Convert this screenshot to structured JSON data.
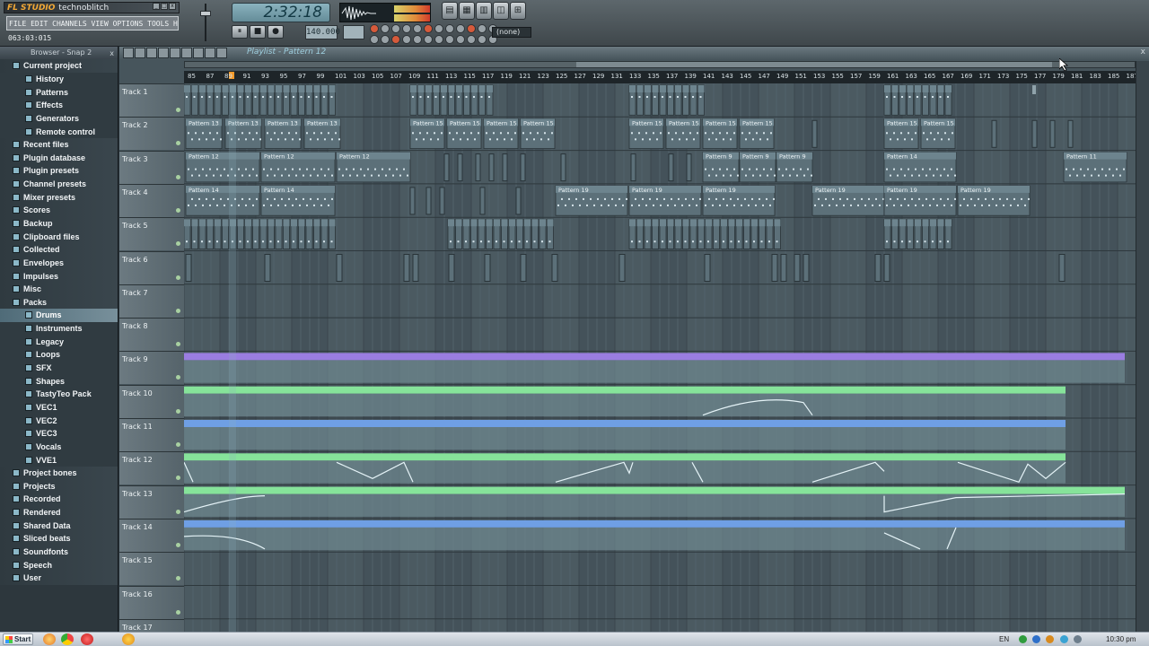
{
  "app": {
    "logo": "FL STUDIO",
    "user": "technoblitch",
    "menu_text": "FILE EDIT CHANNELS VIEW OPTIONS TOOLS HELP",
    "hint": "063:03:015",
    "window_buttons": [
      "_",
      "□",
      "x"
    ]
  },
  "transport": {
    "time_display": "2:32:18",
    "buttons": [
      "⏸",
      "■",
      "●"
    ],
    "bpm_display": "140.000",
    "pattern_selector": "(none)",
    "toolbar_icons": [
      "playlist-icon",
      "step-sequencer-icon",
      "piano-roll-icon",
      "browser-icon",
      "mixer-icon"
    ]
  },
  "browser": {
    "header": "Browser - Snap 2",
    "close": "x",
    "items": [
      {
        "label": "Current project",
        "level": 0
      },
      {
        "label": "History",
        "level": 1
      },
      {
        "label": "Patterns",
        "level": 1
      },
      {
        "label": "Effects",
        "level": 1
      },
      {
        "label": "Generators",
        "level": 1
      },
      {
        "label": "Remote control",
        "level": 1
      },
      {
        "label": "Recent files",
        "level": 0
      },
      {
        "label": "Plugin database",
        "level": 0
      },
      {
        "label": "Plugin presets",
        "level": 0
      },
      {
        "label": "Channel presets",
        "level": 0
      },
      {
        "label": "Mixer presets",
        "level": 0
      },
      {
        "label": "Scores",
        "level": 0
      },
      {
        "label": "Backup",
        "level": 0
      },
      {
        "label": "Clipboard files",
        "level": 0
      },
      {
        "label": "Collected",
        "level": 0
      },
      {
        "label": "Envelopes",
        "level": 0
      },
      {
        "label": "Impulses",
        "level": 0
      },
      {
        "label": "Misc",
        "level": 0
      },
      {
        "label": "Packs",
        "level": 0
      },
      {
        "label": "Drums",
        "level": 1,
        "selected": true
      },
      {
        "label": "Instruments",
        "level": 1
      },
      {
        "label": "Legacy",
        "level": 1
      },
      {
        "label": "Loops",
        "level": 1
      },
      {
        "label": "SFX",
        "level": 1
      },
      {
        "label": "Shapes",
        "level": 1
      },
      {
        "label": "TastyTeo Pack",
        "level": 1
      },
      {
        "label": "VEC1",
        "level": 1
      },
      {
        "label": "VEC2",
        "level": 1
      },
      {
        "label": "VEC3",
        "level": 1
      },
      {
        "label": "Vocals",
        "level": 1
      },
      {
        "label": "VVE1",
        "level": 1
      },
      {
        "label": "Project bones",
        "level": 0
      },
      {
        "label": "Projects",
        "level": 0
      },
      {
        "label": "Recorded",
        "level": 0
      },
      {
        "label": "Rendered",
        "level": 0
      },
      {
        "label": "Shared Data",
        "level": 0
      },
      {
        "label": "Sliced beats",
        "level": 0
      },
      {
        "label": "Soundfonts",
        "level": 0
      },
      {
        "label": "Speech",
        "level": 0
      },
      {
        "label": "User",
        "level": 0
      }
    ]
  },
  "playlist": {
    "title": "Playlist - Pattern 12",
    "close": "x",
    "ruler_labels": [
      "85",
      "87",
      "89",
      "91",
      "93",
      "95",
      "97",
      "99",
      "101",
      "103",
      "105",
      "107",
      "109",
      "111",
      "113",
      "115",
      "117",
      "119",
      "121",
      "123",
      "125",
      "127",
      "129",
      "131",
      "133",
      "135",
      "137",
      "139",
      "141",
      "143",
      "145",
      "147",
      "149",
      "151",
      "153",
      "155",
      "157",
      "159",
      "161",
      "163",
      "165",
      "167",
      "169",
      "171",
      "173",
      "175",
      "177",
      "179",
      "181",
      "183",
      "185",
      "187"
    ],
    "tracks": [
      "Track 1",
      "Track 2",
      "Track 3",
      "Track 4",
      "Track 5",
      "Track 6",
      "Track 7",
      "Track 8",
      "Track 9",
      "Track 10",
      "Track 11",
      "Track 12",
      "Track 13",
      "Track 14",
      "Track 15",
      "Track 16",
      "Track 17"
    ],
    "pattern_names": {
      "track2": [
        "Pattern 13",
        "Pattern 13",
        "Pattern 13",
        "Pattern 13",
        "Pattern 15",
        "Pattern 15",
        "Pattern 15",
        "Pattern 15",
        "Pattern 15",
        "Pattern 15",
        "Pattern 15",
        "Pattern 15",
        "Pattern 15",
        "Pattern 15"
      ],
      "track3": [
        "Pattern 12",
        "Pattern 12",
        "Pattern 12",
        "Pattern 9",
        "Pattern 9",
        "Pattern 9",
        "Pattern 14",
        "Pattern 11"
      ],
      "track4": [
        "Pattern 14",
        "Pattern 14",
        "Pattern 19",
        "Pattern 19",
        "Pattern 19",
        "Pattern 19",
        "Pattern 19",
        "Pattern 19"
      ]
    },
    "colors": {
      "track9": "#9a7de0",
      "track10": "#86e39a",
      "track11": "#6f9fe4",
      "track12": "#86e39a",
      "track13": "#86e39a",
      "track14": "#6f9fe4"
    }
  },
  "taskbar": {
    "start": "Start",
    "apps": [
      "chrome-icon",
      "firefox-icon",
      "opera-icon",
      "fl-studio-icon"
    ],
    "lang": "EN",
    "clock": "10:30 pm"
  }
}
